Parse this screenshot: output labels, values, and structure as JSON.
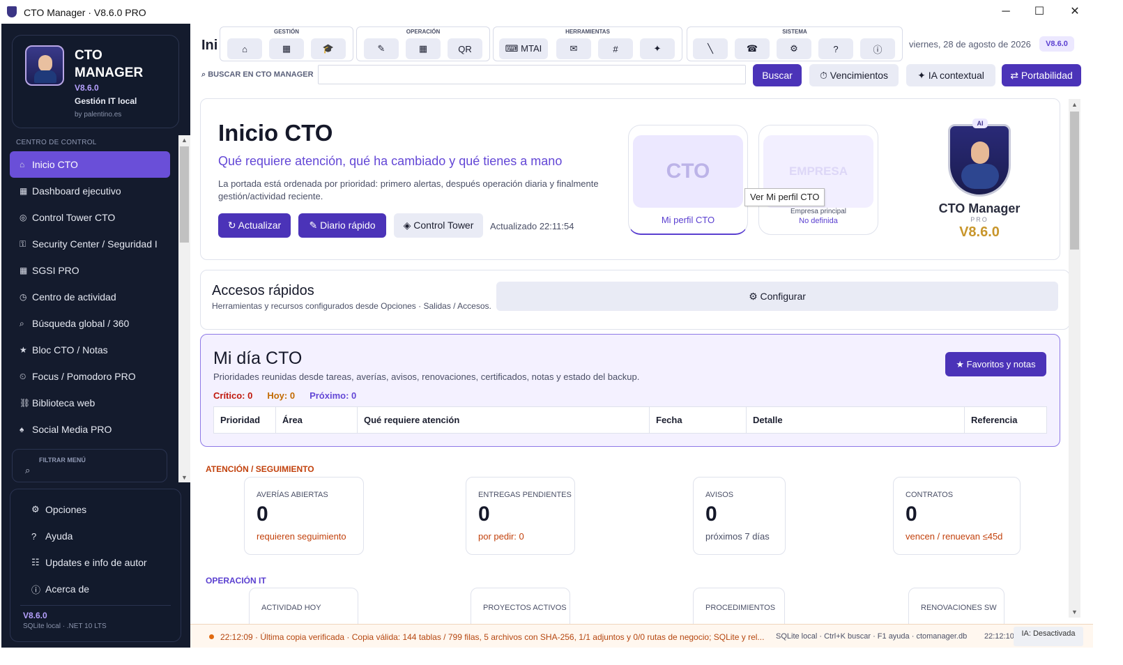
{
  "window": {
    "title": "CTO Manager · V8.6.0 PRO",
    "minimize": "─",
    "maximize": "☐",
    "close": "✕"
  },
  "brand": {
    "name": "CTO MANAGER",
    "version": "V8.6.0",
    "subtitle": "Gestión IT local",
    "by": "by palentino.es"
  },
  "sidebar": {
    "section": "CENTRO DE CONTROL",
    "items": [
      {
        "icon": "⌂",
        "label": "Inicio CTO"
      },
      {
        "icon": "▦",
        "label": "Dashboard ejecutivo"
      },
      {
        "icon": "◎",
        "label": "Control Tower CTO"
      },
      {
        "icon": "⚿",
        "label": "Security Center / Seguridad I"
      },
      {
        "icon": "▦",
        "label": "SGSI PRO"
      },
      {
        "icon": "◷",
        "label": "Centro de actividad"
      },
      {
        "icon": "⌕",
        "label": "Búsqueda global / 360"
      },
      {
        "icon": "★",
        "label": "Bloc CTO / Notas"
      },
      {
        "icon": "⏲",
        "label": "Focus / Pomodoro PRO"
      },
      {
        "icon": "⛓",
        "label": "Biblioteca web"
      },
      {
        "icon": "♠",
        "label": "Social Media PRO"
      }
    ],
    "filter_label": "FILTRAR MENÚ",
    "bottom_items": [
      {
        "icon": "⚙",
        "label": "Opciones"
      },
      {
        "icon": "?",
        "label": "Ayuda"
      },
      {
        "icon": "☷",
        "label": "Updates e info de autor"
      },
      {
        "icon": "ⓘ",
        "label": "Acerca de"
      }
    ],
    "footer_version": "V8.6.0",
    "footer_meta": "SQLite local · .NET 10 LTS"
  },
  "toolbar": {
    "page_cut": "Ini",
    "groups": [
      {
        "label": "GESTIÓN",
        "buttons": [
          "⌂",
          "▦",
          "🎓"
        ]
      },
      {
        "label": "OPERACIÓN",
        "buttons": [
          "✎",
          "▦",
          "QR"
        ]
      },
      {
        "label": "HERRAMIENTAS",
        "buttons": [
          "⌨ MTAI",
          "✉",
          "#",
          "✦"
        ]
      },
      {
        "label": "SISTEMA",
        "buttons": [
          "╲",
          "☎",
          "⚙",
          "?",
          "ⓘ"
        ]
      }
    ],
    "date": "viernes, 28 de agosto de 2026",
    "version_badge": "V8.6.0",
    "search_label": "⌕  BUSCAR EN CTO MANAGER",
    "search_value": "",
    "buscar": "Buscar",
    "vencimientos": "⏱  Vencimientos",
    "ia": "✦  IA contextual",
    "portabilidad": "⇄ Portabilidad"
  },
  "hero": {
    "title": "Inicio CTO",
    "subtitle": "Qué requiere atención, qué ha cambiado y qué tienes a mano",
    "description": "La portada está ordenada por prioridad: primero alertas, después operación diaria y finalmente gestión/actividad reciente.",
    "btn_update": "↻ Actualizar",
    "btn_diary": "✎ Diario rápido",
    "btn_tower": "◈ Control Tower",
    "updated": "Actualizado 22:11:54",
    "profile_cto": {
      "img_text": "CTO",
      "caption": "Mi perfil CTO"
    },
    "profile_company": {
      "img_text": "EMPRESA",
      "label": "Empresa principal",
      "value": "No definida"
    },
    "tooltip": "Ver Mi perfil CTO",
    "logo": {
      "badge": "AI",
      "title": "CTO Manager",
      "pro": "PRO",
      "version": "V8.6.0"
    }
  },
  "quick_access": {
    "title": "Accesos rápidos",
    "subtitle": "Herramientas y recursos configurados desde Opciones · Salidas / Accesos.",
    "configure": "⚙ Configurar"
  },
  "miday": {
    "title": "Mi día CTO",
    "subtitle": "Prioridades reunidas desde tareas, averías, avisos, renovaciones, certificados, notas y estado del backup.",
    "critico": "Crítico: 0",
    "hoy": "Hoy: 0",
    "proximo": "Próximo: 0",
    "favorites": "★ Favoritos y notas",
    "columns": [
      "Prioridad",
      "Área",
      "Qué requiere atención",
      "Fecha",
      "Detalle",
      "Referencia"
    ]
  },
  "attention": {
    "heading": "ATENCIÓN / SEGUIMIENTO",
    "cards": [
      {
        "label": "AVERÍAS ABIERTAS",
        "value": "0",
        "note": "requieren seguimiento"
      },
      {
        "label": "ENTREGAS PENDIENTES",
        "value": "0",
        "note": "por pedir: 0"
      },
      {
        "label": "AVISOS",
        "value": "0",
        "note": "próximos 7 días"
      },
      {
        "label": "CONTRATOS",
        "value": "0",
        "note": "vencen / renuevan ≤45d"
      }
    ]
  },
  "operation": {
    "heading": "OPERACIÓN IT",
    "cards": [
      {
        "label": "ACTIVIDAD HOY"
      },
      {
        "label": "PROYECTOS ACTIVOS"
      },
      {
        "label": "PROCEDIMIENTOS"
      },
      {
        "label": "RENOVACIONES SW"
      }
    ]
  },
  "status": {
    "message": "22:12:09 · Última copia verificada · Copia válida: 144 tablas / 799 filas, 5 archivos con SHA-256, 1/1 adjuntos y 0/0 rutas de negocio; SQLite y rel...",
    "meta": "SQLite local · Ctrl+K buscar · F1 ayuda · ctomanager.db",
    "time": "22:12:10",
    "ia": "IA: Desactivada"
  },
  "colors": {
    "accent": "#4b33b8",
    "active_nav": "#6a4fd8",
    "sidebar": "#141b2d",
    "critical": "#c0180c",
    "today": "#c26a00",
    "next": "#6347d6",
    "warning_text": "#b5460f"
  }
}
